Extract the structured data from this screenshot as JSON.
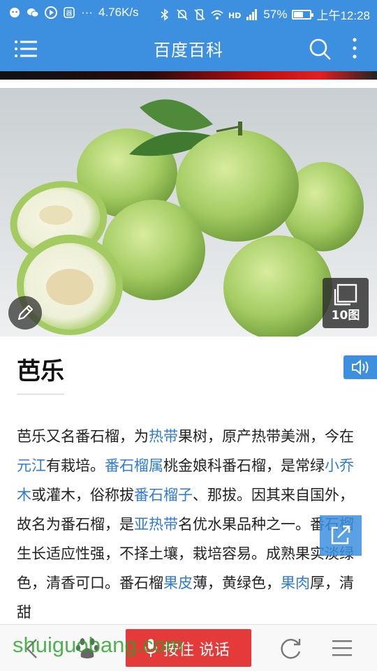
{
  "status_bar": {
    "network_speed": "4.76K/s",
    "battery_percent": "57%",
    "battery_level": 0.57,
    "time": "上午12:28",
    "icons": [
      "notification-icon",
      "wechat-icon",
      "video-icon",
      "app-icon",
      "dots-icon",
      "bluetooth-icon",
      "mute-icon",
      "vibrate-icon",
      "wifi-icon",
      "hd-icon",
      "signal-icon",
      "battery-icon"
    ],
    "dots": "···"
  },
  "app_bar": {
    "title": "百度百科",
    "icons": [
      "menu-icon",
      "search-icon",
      "more-icon"
    ]
  },
  "hero": {
    "image_subject": "guava-photo",
    "gallery_count": "10图",
    "icons": [
      "edit-icon",
      "gallery-icon"
    ]
  },
  "article": {
    "title": "芭乐",
    "segments": [
      {
        "t": "芭乐又名番石榴，为"
      },
      {
        "t": "热带",
        "link": true
      },
      {
        "t": "果树，原产热带美洲，今在"
      },
      {
        "t": "元江",
        "link": true
      },
      {
        "t": "有栽培。"
      },
      {
        "t": "番石榴属",
        "link": true
      },
      {
        "t": "桃金娘科番石榴，是常绿"
      },
      {
        "t": "小乔木",
        "link": true
      },
      {
        "t": "或灌木，俗称拔"
      },
      {
        "t": "番石榴子",
        "link": true
      },
      {
        "t": "、那拔。因其来自国外，故名为番石榴，是"
      },
      {
        "t": "亚热带",
        "link": true
      },
      {
        "t": "名优水果品种之一。番石榴生长适应性强，不择土壤，栽培容易。成熟果实淡绿色，清香可口。番石榴"
      },
      {
        "t": "果皮",
        "link": true
      },
      {
        "t": "薄，黄绿色，"
      },
      {
        "t": "果肉",
        "link": true
      },
      {
        "t": "厚，清甜"
      }
    ],
    "icons": [
      "speaker-icon",
      "share-icon"
    ]
  },
  "bottom_bar": {
    "voice_label": "按住 说话",
    "icons": [
      "back-icon",
      "paw-icon",
      "microphone-icon",
      "refresh-icon",
      "list-icon"
    ]
  },
  "watermark": "shuiguobang.com",
  "colors": {
    "brand_blue": "#3d8fe0",
    "link_blue": "#2f7bd6",
    "voice_red": "#e53a3a"
  }
}
